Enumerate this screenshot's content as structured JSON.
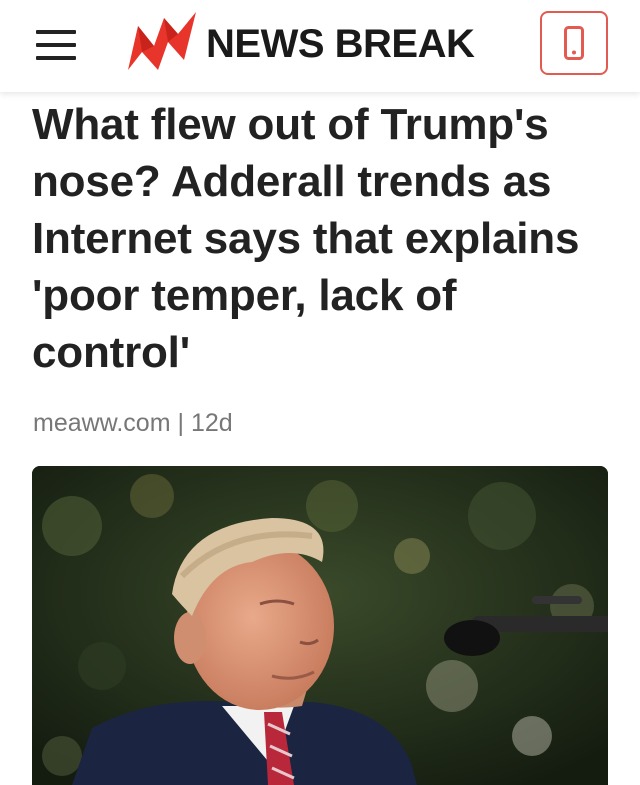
{
  "header": {
    "menu_icon": "hamburger-menu-icon",
    "logo_icon": "newsbreak-logo-icon",
    "brand_name": "NEWS BREAK",
    "app_button_icon": "mobile-phone-icon",
    "brand_color": "#e8352b"
  },
  "article": {
    "headline": "What flew out of Trump's nose? Adderall trends as Internet says that explains 'poor temper, lack of control'",
    "source": "meaww.com",
    "separator": "|",
    "age": "12d",
    "image": {
      "subject": "man-at-podium-photo"
    }
  }
}
